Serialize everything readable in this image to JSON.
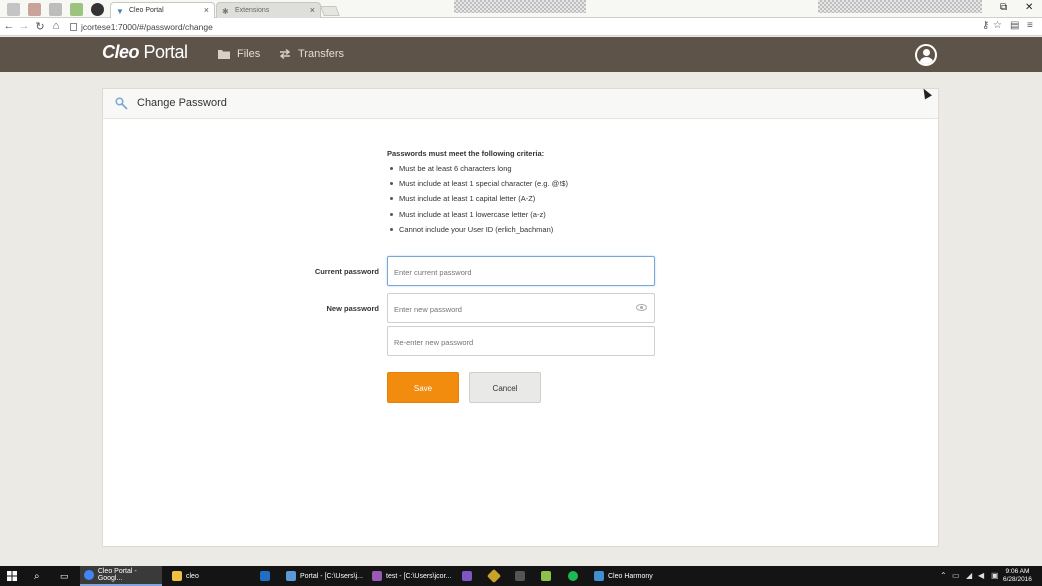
{
  "browser": {
    "tabs": [
      {
        "title": "Cleo Portal",
        "active": true
      },
      {
        "title": "Extensions",
        "active": false
      }
    ],
    "url": "jcortese1:7000/#/password/change",
    "window_controls": {
      "restore": "⧉",
      "close": "✕"
    }
  },
  "app": {
    "logo_bold": "Cleo",
    "logo_rest": " Portal",
    "nav": [
      {
        "label": "Files",
        "icon": "folder-icon"
      },
      {
        "label": "Transfers",
        "icon": "transfer-arrows-icon"
      }
    ],
    "user_icon": "user-avatar-icon"
  },
  "card": {
    "title": "Change Password",
    "criteria_title": "Passwords must meet the following criteria:",
    "criteria": [
      "Must be at least 6 characters long",
      "Must include at least 1 special character (e.g. @!$)",
      "Must include at least 1 capital letter (A-Z)",
      "Must include at least 1 lowercase letter (a-z)",
      "Cannot include your User ID (erlich_bachman)"
    ],
    "current_label": "Current password",
    "current_placeholder": "Enter current password",
    "new_label": "New password",
    "new_placeholder": "Enter new password",
    "reenter_placeholder": "Re-enter new password",
    "save_label": "Save",
    "cancel_label": "Cancel"
  },
  "taskbar": {
    "items": [
      {
        "label": "Cleo Portal - Googl...",
        "color": "#4285f4",
        "active": true
      },
      {
        "label": "cleo",
        "color": "#f0c040",
        "active": false
      },
      {
        "label": "",
        "color": "#1e6fc8",
        "active": false
      },
      {
        "label": "Portal - [C:\\Users\\j...",
        "color": "#5a9bd5",
        "active": false
      },
      {
        "label": "test - [C:\\Users\\jcor...",
        "color": "#9b59b6",
        "active": false
      },
      {
        "label": "",
        "color": "#7e57c2",
        "active": false
      },
      {
        "label": "",
        "color": "#c9a227",
        "active": false
      },
      {
        "label": "",
        "color": "#555555",
        "active": false
      },
      {
        "label": "",
        "color": "#8bc34a",
        "active": false
      },
      {
        "label": "",
        "color": "#1db954",
        "active": false
      },
      {
        "label": "Cleo Harmony",
        "color": "#3f8fd2",
        "active": false
      }
    ],
    "time": "9:06 AM",
    "date": "6/28/2016"
  },
  "colors": {
    "header_bg": "#5d5349",
    "save_button": "#f28c0f",
    "page_bg": "#eceae4"
  }
}
